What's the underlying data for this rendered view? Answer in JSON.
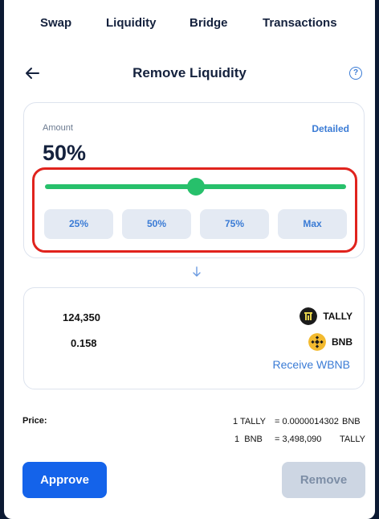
{
  "nav": {
    "tabs": [
      {
        "label": "Swap"
      },
      {
        "label": "Liquidity"
      },
      {
        "label": "Bridge"
      },
      {
        "label": "Transactions"
      }
    ]
  },
  "header": {
    "title": "Remove Liquidity",
    "help_glyph": "?"
  },
  "amount": {
    "label": "Amount",
    "detailed_link": "Detailed",
    "value": "50%",
    "slider_fraction": 0.5,
    "quick_buttons": [
      "25%",
      "50%",
      "75%",
      "Max"
    ]
  },
  "receive": {
    "tokens": [
      {
        "amount": "124,350",
        "symbol": "TALLY",
        "icon": "tally-icon"
      },
      {
        "amount": "0.158",
        "symbol": "BNB",
        "icon": "bnb-icon"
      }
    ],
    "receive_wbnb_link": "Receive WBNB"
  },
  "price": {
    "label": "Price:",
    "line1_left": "1 TALLY",
    "line1_mid": "= 0.0000014302",
    "line1_right": "BNB",
    "line2_left": "1  BNB",
    "line2_mid": "= 3,498,090",
    "line2_right": "TALLY"
  },
  "actions": {
    "approve": "Approve",
    "remove": "Remove"
  },
  "colors": {
    "accent": "#1463ea",
    "slider": "#27c06b",
    "highlight": "#e0231d",
    "disabled": "#cdd6e3"
  }
}
